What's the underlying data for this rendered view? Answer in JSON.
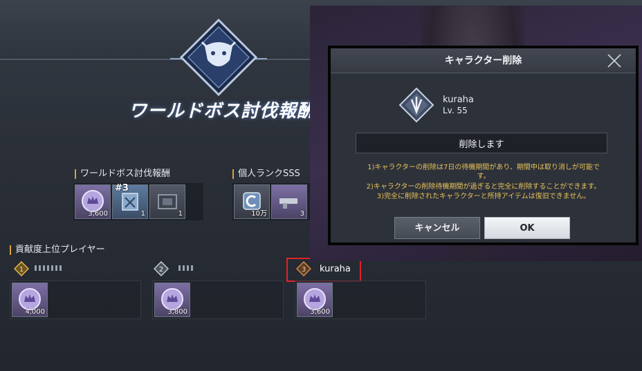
{
  "reward_screen": {
    "title": "ワールドボス討伐報酬",
    "boss_reward_section": {
      "label": "ワールドボス討伐報酬",
      "items": [
        {
          "icon": "crown-coin-icon",
          "count": "3,600"
        },
        {
          "icon": "equipment-box-icon",
          "count": "1"
        },
        {
          "icon": "armor-crate-icon",
          "count": "1"
        }
      ],
      "rank_marker": "#3"
    },
    "personal_rank_section": {
      "label": "個人ランクSSS",
      "items": [
        {
          "icon": "c-ticket-icon",
          "count": "10万"
        },
        {
          "icon": "weapon-icon",
          "count": "3"
        }
      ]
    },
    "contributors": {
      "heading": "貢献度上位プレイヤー",
      "players": [
        {
          "rank_icon": "rank-1-badge-icon",
          "name": "",
          "reward_count": "4,000"
        },
        {
          "rank_icon": "rank-2-badge-icon",
          "name": "",
          "reward_count": "3,800"
        },
        {
          "rank_icon": "rank-3-badge-icon",
          "name": "kuraha",
          "reward_count": "3,600"
        }
      ]
    }
  },
  "dialog": {
    "title": "キャラクター削除",
    "character": {
      "name": "kuraha",
      "level": "Lv. 55"
    },
    "input_value": "削除します",
    "notices": [
      "1)キャラクターの削除は7日の待機期間があり、期間中は取り消しが可能で",
      "す。",
      "2)キャラクターの削除待機期間が過ぎると完全に削除することができます。",
      "3)完全に削除されたキャラクターと所持アイテムは復旧できません。"
    ],
    "cancel_label": "キャンセル",
    "ok_label": "OK"
  },
  "colors": {
    "accent_gold": "#d9a23a",
    "notice_text": "#e8c25a",
    "highlight_red": "#e2222a"
  }
}
